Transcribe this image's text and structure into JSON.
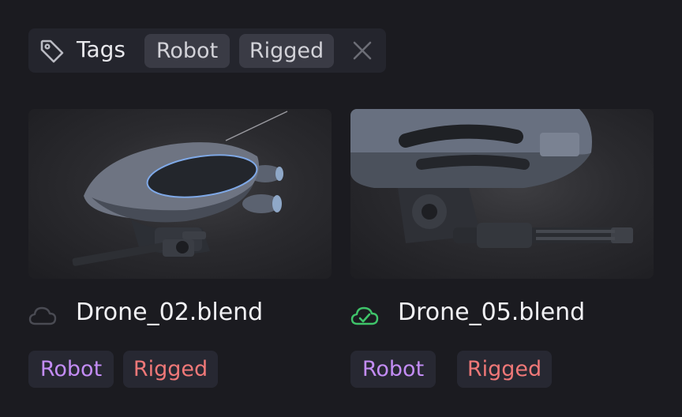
{
  "filter": {
    "icon": "tag-icon",
    "label": "Tags",
    "chips": [
      "Robot",
      "Rigged"
    ],
    "clear_icon": "close-icon"
  },
  "assets": [
    {
      "name": "Drone_02.blend",
      "sync_icon": "cloud-icon",
      "sync_status": "not-synced",
      "sync_color": "#4a4b53",
      "thumbnail": "hovering combat drone with rotary cannon, side view",
      "tags": [
        "Robot",
        "Rigged"
      ]
    },
    {
      "name": "Drone_05.blend",
      "sync_icon": "cloud-check-icon",
      "sync_status": "synced",
      "sync_color": "#3fc46a",
      "thumbnail": "close-up of combat drone underside with gatling gun",
      "tags": [
        "Robot",
        "Rigged"
      ]
    }
  ],
  "colors": {
    "background": "#1b1b20",
    "tag_robot": "#c38cf5",
    "tag_rigged": "#f07878",
    "synced": "#3fc46a"
  }
}
